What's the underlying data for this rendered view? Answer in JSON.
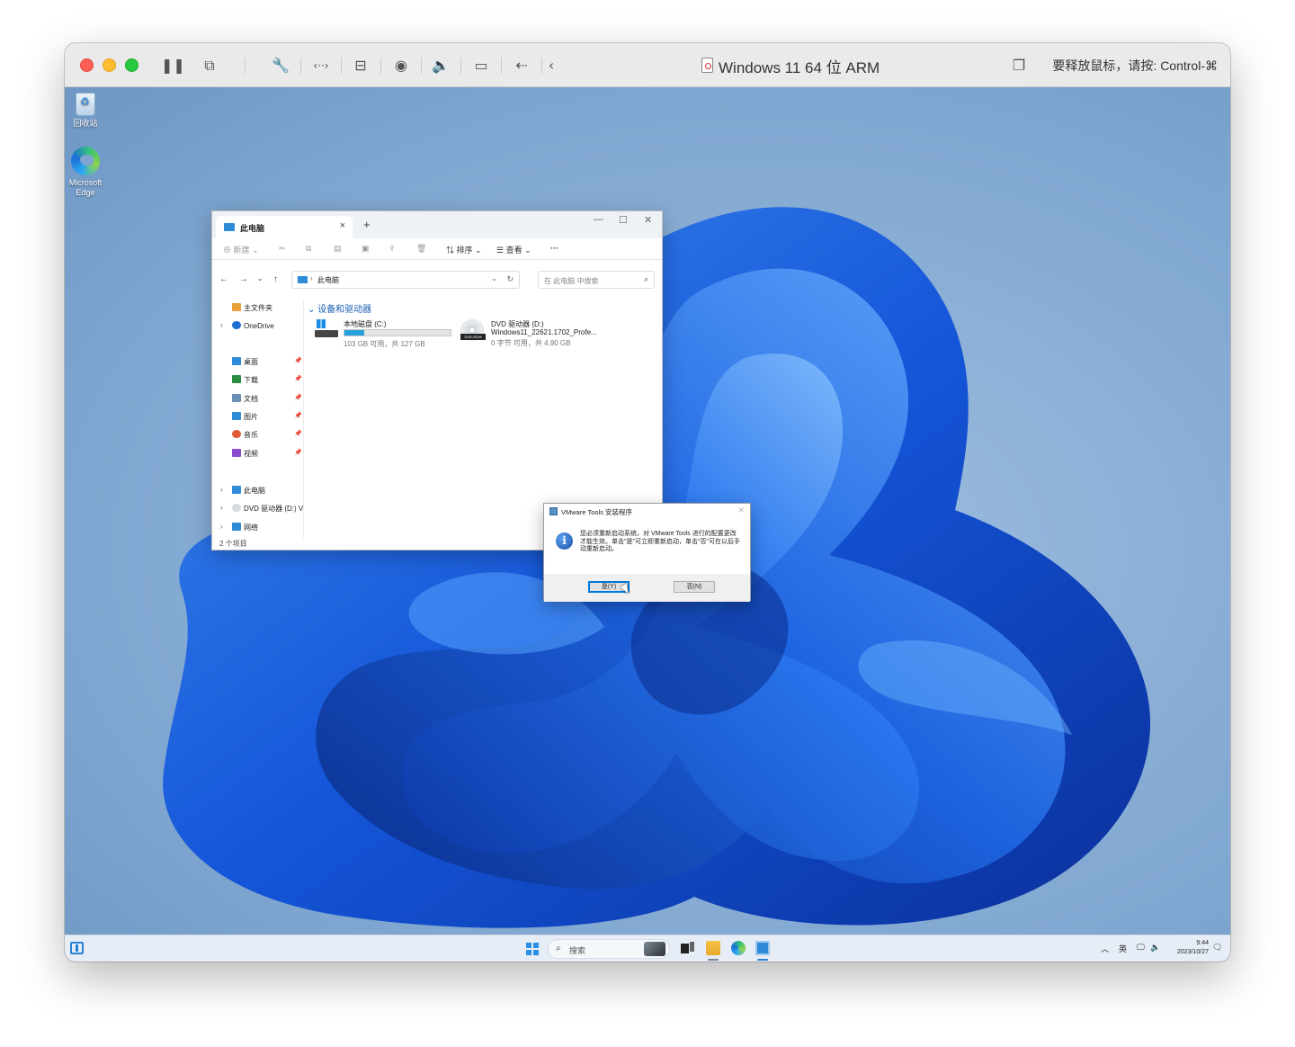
{
  "host": {
    "vm_title": "Windows 11 64 位 ARM",
    "release_hint": "要释放鼠标，请按: Control-⌘",
    "toolbar_icons": [
      "pause-icon",
      "snapshot-icon",
      "settings-wrench-icon",
      "code-icon",
      "hard-disk-icon",
      "camera-user-icon",
      "volume-icon",
      "video-icon",
      "usb-icon",
      "back-icon",
      "window-copy-icon"
    ]
  },
  "desktop": {
    "icons": [
      {
        "label": "回收站"
      },
      {
        "label": "Microsoft Edge"
      }
    ]
  },
  "explorer": {
    "tab_label": "此电脑",
    "new_label": "新建",
    "sort_label": "排序",
    "view_label": "查看",
    "more_label": "···",
    "address_crumb": "此电脑",
    "search_placeholder": "在 此电脑 中搜索",
    "nav": {
      "home": "主文件夹",
      "onedrive": "OneDrive",
      "pinned": [
        {
          "label": "桌面",
          "color": "#2d8bd8"
        },
        {
          "label": "下载",
          "color": "#2a8a3f"
        },
        {
          "label": "文档",
          "color": "#6c8fb5"
        },
        {
          "label": "图片",
          "color": "#2d8bd8"
        },
        {
          "label": "音乐",
          "color": "#e05a3a"
        },
        {
          "label": "视频",
          "color": "#8a4bd1"
        }
      ],
      "this_pc": "此电脑",
      "dvd": "DVD 驱动器 (D:) V",
      "network": "网络"
    },
    "section_title": "设备和驱动器",
    "drive_c": {
      "name": "本地磁盘 (C:)",
      "free": "103 GB 可用，共 127 GB",
      "used_fraction": 0.19
    },
    "drive_d": {
      "name": "DVD 驱动器 (D:)",
      "volume": "Windows11_22621.1702_Profe...",
      "free": "0 字节 可用，共 4.90 GB",
      "badge": "DVD-ROM"
    },
    "status": "2 个项目"
  },
  "dialog": {
    "title": "VMware Tools 安装程序",
    "message": "您必须重新启动系统，对 VMware Tools 进行的配置更改才能生效。单击\"是\"可立即重新启动，单击\"否\"可在以后手动重新启动。",
    "yes_label": "是(Y)",
    "no_label": "否(N)"
  },
  "taskbar": {
    "search_placeholder": "搜索",
    "ime": "英",
    "time": "9:44",
    "date": "2023/10/27"
  }
}
